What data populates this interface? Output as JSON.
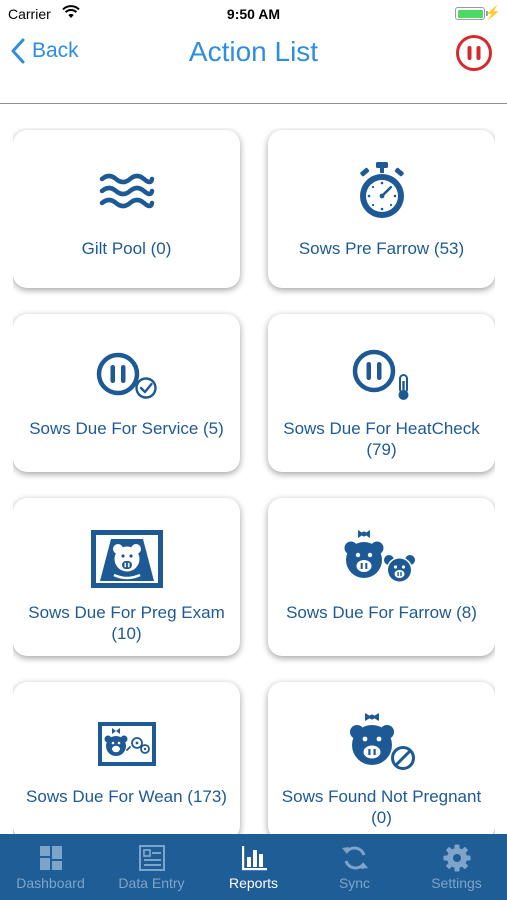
{
  "status_bar": {
    "carrier": "Carrier",
    "time": "9:50 AM"
  },
  "nav": {
    "back_label": "Back",
    "title": "Action List"
  },
  "cards": [
    {
      "label": "Gilt Pool (0)",
      "icon": "waves-icon"
    },
    {
      "label": "Sows Pre Farrow (53)",
      "icon": "stopwatch-icon"
    },
    {
      "label": "Sows Due For Service (5)",
      "icon": "pig-snout-check-icon"
    },
    {
      "label": "Sows Due For HeatCheck (79)",
      "icon": "pig-snout-thermometer-icon"
    },
    {
      "label": "Sows Due For Preg Exam (10)",
      "icon": "ultrasound-pig-icon"
    },
    {
      "label": "Sows Due For Farrow (8)",
      "icon": "sow-and-piglet-icon"
    },
    {
      "label": "Sows Due For Wean (173)",
      "icon": "piglet-weaning-icon"
    },
    {
      "label": "Sows Found Not Pregnant (0)",
      "icon": "sow-not-pregnant-icon"
    }
  ],
  "tabs": [
    {
      "label": "Dashboard",
      "icon": "dashboard-icon",
      "active": false
    },
    {
      "label": "Data Entry",
      "icon": "data-entry-icon",
      "active": false
    },
    {
      "label": "Reports",
      "icon": "reports-icon",
      "active": true
    },
    {
      "label": "Sync",
      "icon": "sync-icon",
      "active": false
    },
    {
      "label": "Settings",
      "icon": "gear-icon",
      "active": false
    }
  ],
  "colors": {
    "brand_blue": "#1d5a95",
    "link_blue": "#2f8ee0",
    "accent_red": "#d62a2a",
    "tab_bar": "#1f5d97"
  }
}
